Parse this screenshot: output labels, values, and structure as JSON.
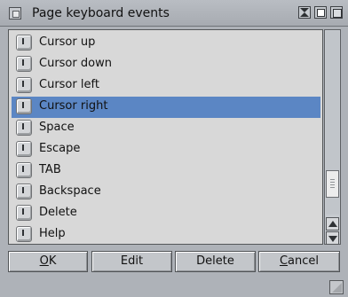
{
  "window": {
    "title": "Page keyboard events"
  },
  "list": {
    "items": [
      {
        "label": "Cursor up",
        "icon": "key-icon"
      },
      {
        "label": "Cursor down",
        "icon": "key-icon"
      },
      {
        "label": "Cursor left",
        "icon": "key-icon"
      },
      {
        "label": "Cursor right",
        "icon": "key-icon",
        "selected": true
      },
      {
        "label": "Space",
        "icon": "key-icon"
      },
      {
        "label": "Escape",
        "icon": "key-icon"
      },
      {
        "label": "TAB",
        "icon": "key-icon"
      },
      {
        "label": "Backspace",
        "icon": "key-icon"
      },
      {
        "label": "Delete",
        "icon": "key-icon"
      },
      {
        "label": "Help",
        "icon": "key-icon"
      }
    ],
    "selected_color": "#5b86c4"
  },
  "buttons": {
    "ok_first": "O",
    "ok_rest": "K",
    "edit": "Edit",
    "delete": "Delete",
    "cancel_first": "C",
    "cancel_rest": "ancel"
  }
}
